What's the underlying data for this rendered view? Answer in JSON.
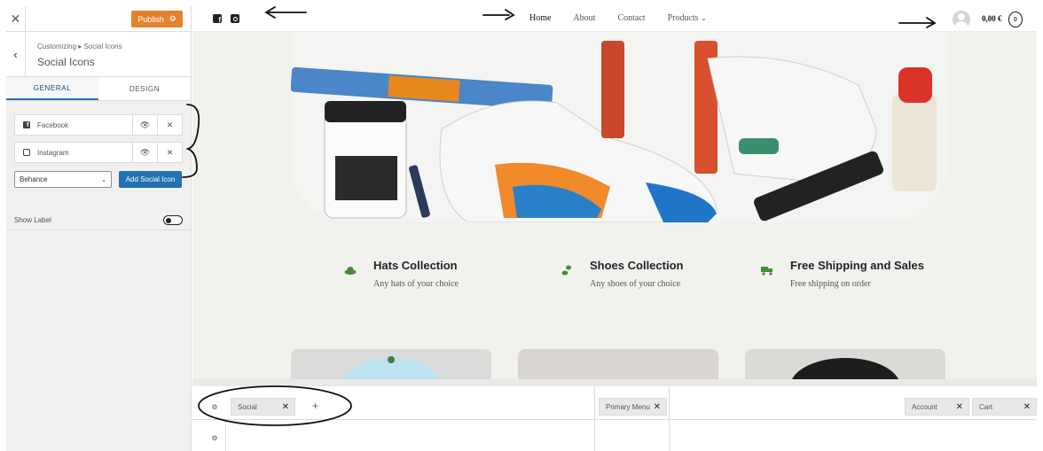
{
  "customizer": {
    "close_icon": "close-icon",
    "publish_label": "Publish",
    "breadcrumb": "Customizing ▸ Social Icons",
    "section_title": "Social Icons",
    "tabs": [
      {
        "label": "GENERAL",
        "active": true
      },
      {
        "label": "DESIGN",
        "active": false
      }
    ],
    "social_items": [
      {
        "label": "Facebook",
        "icon": "facebook-icon"
      },
      {
        "label": "Instagram",
        "icon": "instagram-icon"
      }
    ],
    "network_select_value": "Behance",
    "add_button_label": "Add Social Icon",
    "show_label_text": "Show Label",
    "show_label_enabled": false,
    "accent_color": "#2271b1",
    "publish_color": "#e4812e"
  },
  "site": {
    "nav": [
      {
        "label": "Home",
        "active": true
      },
      {
        "label": "About",
        "active": false
      },
      {
        "label": "Contact",
        "active": false
      },
      {
        "label": "Products",
        "active": false,
        "has_dropdown": true
      }
    ],
    "cart_total": "0,00 €",
    "cart_count": "0",
    "features": [
      {
        "title": "Hats Collection",
        "subtitle": "Any hats of your choice",
        "icon": "hat-icon"
      },
      {
        "title": "Shoes Collection",
        "subtitle": "Any shoes of your choice",
        "icon": "footprints-icon"
      },
      {
        "title": "Free Shipping and Sales",
        "subtitle": "Free shipping on order",
        "icon": "truck-icon"
      }
    ],
    "feature_icon_color": "#4a8a3c"
  },
  "builder": {
    "chips": {
      "social": "Social",
      "primary_menu": "Primary Menu",
      "account": "Account",
      "cart": "Cart"
    },
    "add_symbol": "+"
  }
}
